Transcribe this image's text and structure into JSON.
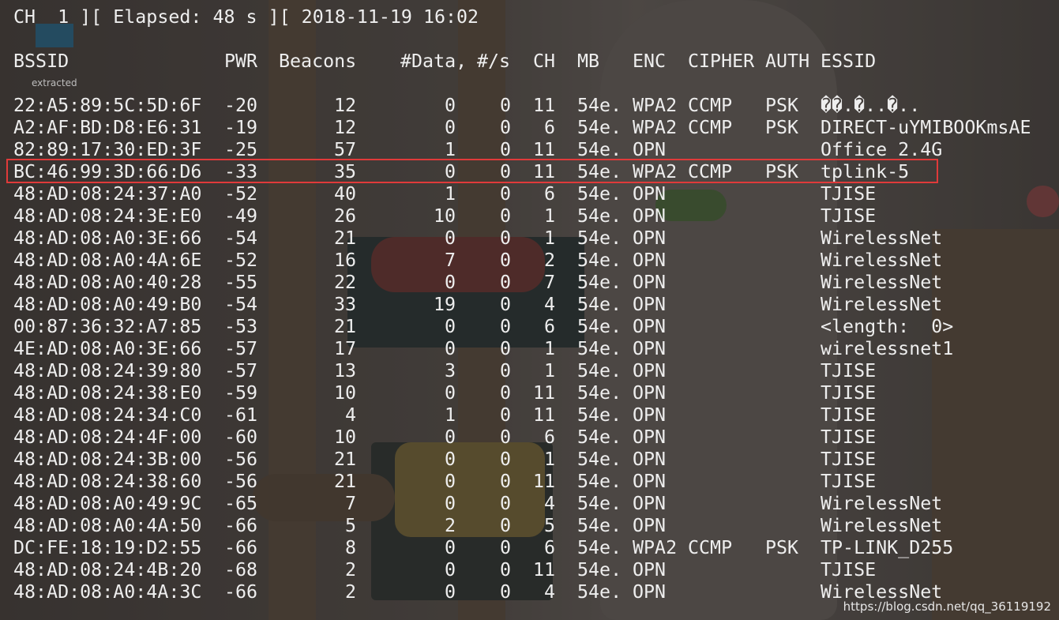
{
  "status_line": "CH  1 ][ Elapsed: 48 s ][ 2018-11-19 16:02",
  "extracted_label": "extracted",
  "headers": {
    "bssid": "BSSID",
    "pwr": "PWR",
    "beacons": "Beacons",
    "data": "#Data,",
    "rate": "#/s",
    "ch": "CH",
    "mb": "MB",
    "enc": "ENC",
    "cipher": "CIPHER",
    "auth": "AUTH",
    "essid": "ESSID"
  },
  "rows": [
    {
      "bssid": "22:A5:89:5C:5D:6F",
      "pwr": "-20",
      "beacons": "12",
      "data": "0",
      "rate": "0",
      "ch": "11",
      "mb": "54e.",
      "enc": "WPA2",
      "cipher": "CCMP",
      "auth": "PSK",
      "essid": "��.�..�.."
    },
    {
      "bssid": "A2:AF:BD:D8:E6:31",
      "pwr": "-19",
      "beacons": "12",
      "data": "0",
      "rate": "0",
      "ch": "6",
      "mb": "54e.",
      "enc": "WPA2",
      "cipher": "CCMP",
      "auth": "PSK",
      "essid": "DIRECT-uYMIBOOKmsAE"
    },
    {
      "bssid": "82:89:17:30:ED:3F",
      "pwr": "-25",
      "beacons": "57",
      "data": "1",
      "rate": "0",
      "ch": "11",
      "mb": "54e.",
      "enc": "OPN",
      "cipher": "",
      "auth": "",
      "essid": "Office_2.4G"
    },
    {
      "bssid": "BC:46:99:3D:66:D6",
      "pwr": "-33",
      "beacons": "35",
      "data": "0",
      "rate": "0",
      "ch": "11",
      "mb": "54e.",
      "enc": "WPA2",
      "cipher": "CCMP",
      "auth": "PSK",
      "essid": "tplink-5"
    },
    {
      "bssid": "48:AD:08:24:37:A0",
      "pwr": "-52",
      "beacons": "40",
      "data": "1",
      "rate": "0",
      "ch": "6",
      "mb": "54e.",
      "enc": "OPN",
      "cipher": "",
      "auth": "",
      "essid": "TJISE"
    },
    {
      "bssid": "48:AD:08:24:3E:E0",
      "pwr": "-49",
      "beacons": "26",
      "data": "10",
      "rate": "0",
      "ch": "1",
      "mb": "54e.",
      "enc": "OPN",
      "cipher": "",
      "auth": "",
      "essid": "TJISE"
    },
    {
      "bssid": "48:AD:08:A0:3E:66",
      "pwr": "-54",
      "beacons": "21",
      "data": "0",
      "rate": "0",
      "ch": "1",
      "mb": "54e.",
      "enc": "OPN",
      "cipher": "",
      "auth": "",
      "essid": "WirelessNet"
    },
    {
      "bssid": "48:AD:08:A0:4A:6E",
      "pwr": "-52",
      "beacons": "16",
      "data": "7",
      "rate": "0",
      "ch": "2",
      "mb": "54e.",
      "enc": "OPN",
      "cipher": "",
      "auth": "",
      "essid": "WirelessNet"
    },
    {
      "bssid": "48:AD:08:A0:40:28",
      "pwr": "-55",
      "beacons": "22",
      "data": "0",
      "rate": "0",
      "ch": "7",
      "mb": "54e.",
      "enc": "OPN",
      "cipher": "",
      "auth": "",
      "essid": "WirelessNet"
    },
    {
      "bssid": "48:AD:08:A0:49:B0",
      "pwr": "-54",
      "beacons": "33",
      "data": "19",
      "rate": "0",
      "ch": "4",
      "mb": "54e.",
      "enc": "OPN",
      "cipher": "",
      "auth": "",
      "essid": "WirelessNet"
    },
    {
      "bssid": "00:87:36:32:A7:85",
      "pwr": "-53",
      "beacons": "21",
      "data": "0",
      "rate": "0",
      "ch": "6",
      "mb": "54e.",
      "enc": "OPN",
      "cipher": "",
      "auth": "",
      "essid": "<length:  0>"
    },
    {
      "bssid": "4E:AD:08:A0:3E:66",
      "pwr": "-57",
      "beacons": "17",
      "data": "0",
      "rate": "0",
      "ch": "1",
      "mb": "54e.",
      "enc": "OPN",
      "cipher": "",
      "auth": "",
      "essid": "wirelessnet1"
    },
    {
      "bssid": "48:AD:08:24:39:80",
      "pwr": "-57",
      "beacons": "13",
      "data": "3",
      "rate": "0",
      "ch": "1",
      "mb": "54e.",
      "enc": "OPN",
      "cipher": "",
      "auth": "",
      "essid": "TJISE"
    },
    {
      "bssid": "48:AD:08:24:38:E0",
      "pwr": "-59",
      "beacons": "10",
      "data": "0",
      "rate": "0",
      "ch": "11",
      "mb": "54e.",
      "enc": "OPN",
      "cipher": "",
      "auth": "",
      "essid": "TJISE"
    },
    {
      "bssid": "48:AD:08:24:34:C0",
      "pwr": "-61",
      "beacons": "4",
      "data": "1",
      "rate": "0",
      "ch": "11",
      "mb": "54e.",
      "enc": "OPN",
      "cipher": "",
      "auth": "",
      "essid": "TJISE"
    },
    {
      "bssid": "48:AD:08:24:4F:00",
      "pwr": "-60",
      "beacons": "10",
      "data": "0",
      "rate": "0",
      "ch": "6",
      "mb": "54e.",
      "enc": "OPN",
      "cipher": "",
      "auth": "",
      "essid": "TJISE"
    },
    {
      "bssid": "48:AD:08:24:3B:00",
      "pwr": "-56",
      "beacons": "21",
      "data": "0",
      "rate": "0",
      "ch": "1",
      "mb": "54e.",
      "enc": "OPN",
      "cipher": "",
      "auth": "",
      "essid": "TJISE"
    },
    {
      "bssid": "48:AD:08:24:38:60",
      "pwr": "-56",
      "beacons": "21",
      "data": "0",
      "rate": "0",
      "ch": "11",
      "mb": "54e.",
      "enc": "OPN",
      "cipher": "",
      "auth": "",
      "essid": "TJISE"
    },
    {
      "bssid": "48:AD:08:A0:49:9C",
      "pwr": "-65",
      "beacons": "7",
      "data": "0",
      "rate": "0",
      "ch": "4",
      "mb": "54e.",
      "enc": "OPN",
      "cipher": "",
      "auth": "",
      "essid": "WirelessNet"
    },
    {
      "bssid": "48:AD:08:A0:4A:50",
      "pwr": "-66",
      "beacons": "5",
      "data": "2",
      "rate": "0",
      "ch": "5",
      "mb": "54e.",
      "enc": "OPN",
      "cipher": "",
      "auth": "",
      "essid": "WirelessNet"
    },
    {
      "bssid": "DC:FE:18:19:D2:55",
      "pwr": "-66",
      "beacons": "8",
      "data": "0",
      "rate": "0",
      "ch": "6",
      "mb": "54e.",
      "enc": "WPA2",
      "cipher": "CCMP",
      "auth": "PSK",
      "essid": "TP-LINK_D255"
    },
    {
      "bssid": "48:AD:08:24:4B:20",
      "pwr": "-68",
      "beacons": "2",
      "data": "0",
      "rate": "0",
      "ch": "11",
      "mb": "54e.",
      "enc": "OPN",
      "cipher": "",
      "auth": "",
      "essid": "TJISE"
    },
    {
      "bssid": "48:AD:08:A0:4A:3C",
      "pwr": "-66",
      "beacons": "2",
      "data": "0",
      "rate": "0",
      "ch": "4",
      "mb": "54e.",
      "enc": "OPN",
      "cipher": "",
      "auth": "",
      "essid": "WirelessNet"
    }
  ],
  "highlighted_row": 3,
  "highlight_color": "#e03a3a",
  "watermark": "https://blog.csdn.net/qq_36119192"
}
